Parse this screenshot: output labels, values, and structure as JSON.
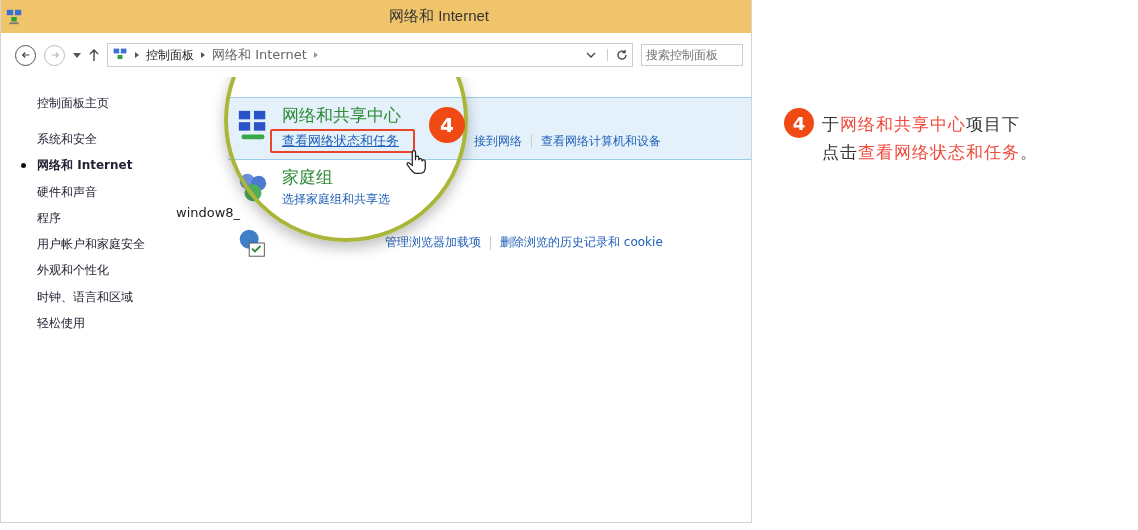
{
  "window": {
    "title": "网络和 Internet"
  },
  "address_bar": {
    "path": [
      {
        "label": "控制面板"
      },
      {
        "label": "网络和 Internet"
      }
    ],
    "search": {
      "placeholder": "搜索控制面板"
    }
  },
  "sidebar": {
    "home": "控制面板主页",
    "items": [
      {
        "label": "系统和安全",
        "selected": false
      },
      {
        "label": "网络和 Internet",
        "selected": true
      },
      {
        "label": "硬件和声音",
        "selected": false
      },
      {
        "label": "程序",
        "selected": false
      },
      {
        "label": "用户帐户和家庭安全",
        "selected": false
      },
      {
        "label": "外观和个性化",
        "selected": false
      },
      {
        "label": "时钟、语言和区域",
        "selected": false
      },
      {
        "label": "轻松使用",
        "selected": false
      }
    ]
  },
  "stray_text": "window8_",
  "categories": [
    {
      "kind": "network",
      "title": "网络和共享中心",
      "highlighted": true,
      "links": [
        {
          "label": "查看网络状态和任务",
          "boxed": true
        },
        {
          "label": "接到网络",
          "boxed": false
        },
        {
          "label": "查看网络计算机和设备",
          "boxed": false
        }
      ]
    },
    {
      "kind": "homegroup",
      "title": "家庭组",
      "highlighted": false,
      "links": [
        {
          "label": "选择家庭组和共享选",
          "boxed": false
        }
      ]
    },
    {
      "kind": "internet",
      "highlighted": false,
      "links": [
        {
          "label": "管理浏览器加载项",
          "boxed": false
        },
        {
          "label": "删除浏览的历史记录和 cookie",
          "boxed": false
        }
      ]
    }
  ],
  "step_badge": "4",
  "annotation": {
    "badge": "4",
    "lines": [
      [
        {
          "text": "于",
          "highlight": false
        },
        {
          "text": "网络和共享中心",
          "highlight": true
        },
        {
          "text": "项目下",
          "highlight": false
        }
      ],
      [
        {
          "text": "点击",
          "highlight": false
        },
        {
          "text": "查看网络状态和任务",
          "highlight": true
        },
        {
          "text": "。",
          "highlight": false
        }
      ]
    ]
  }
}
